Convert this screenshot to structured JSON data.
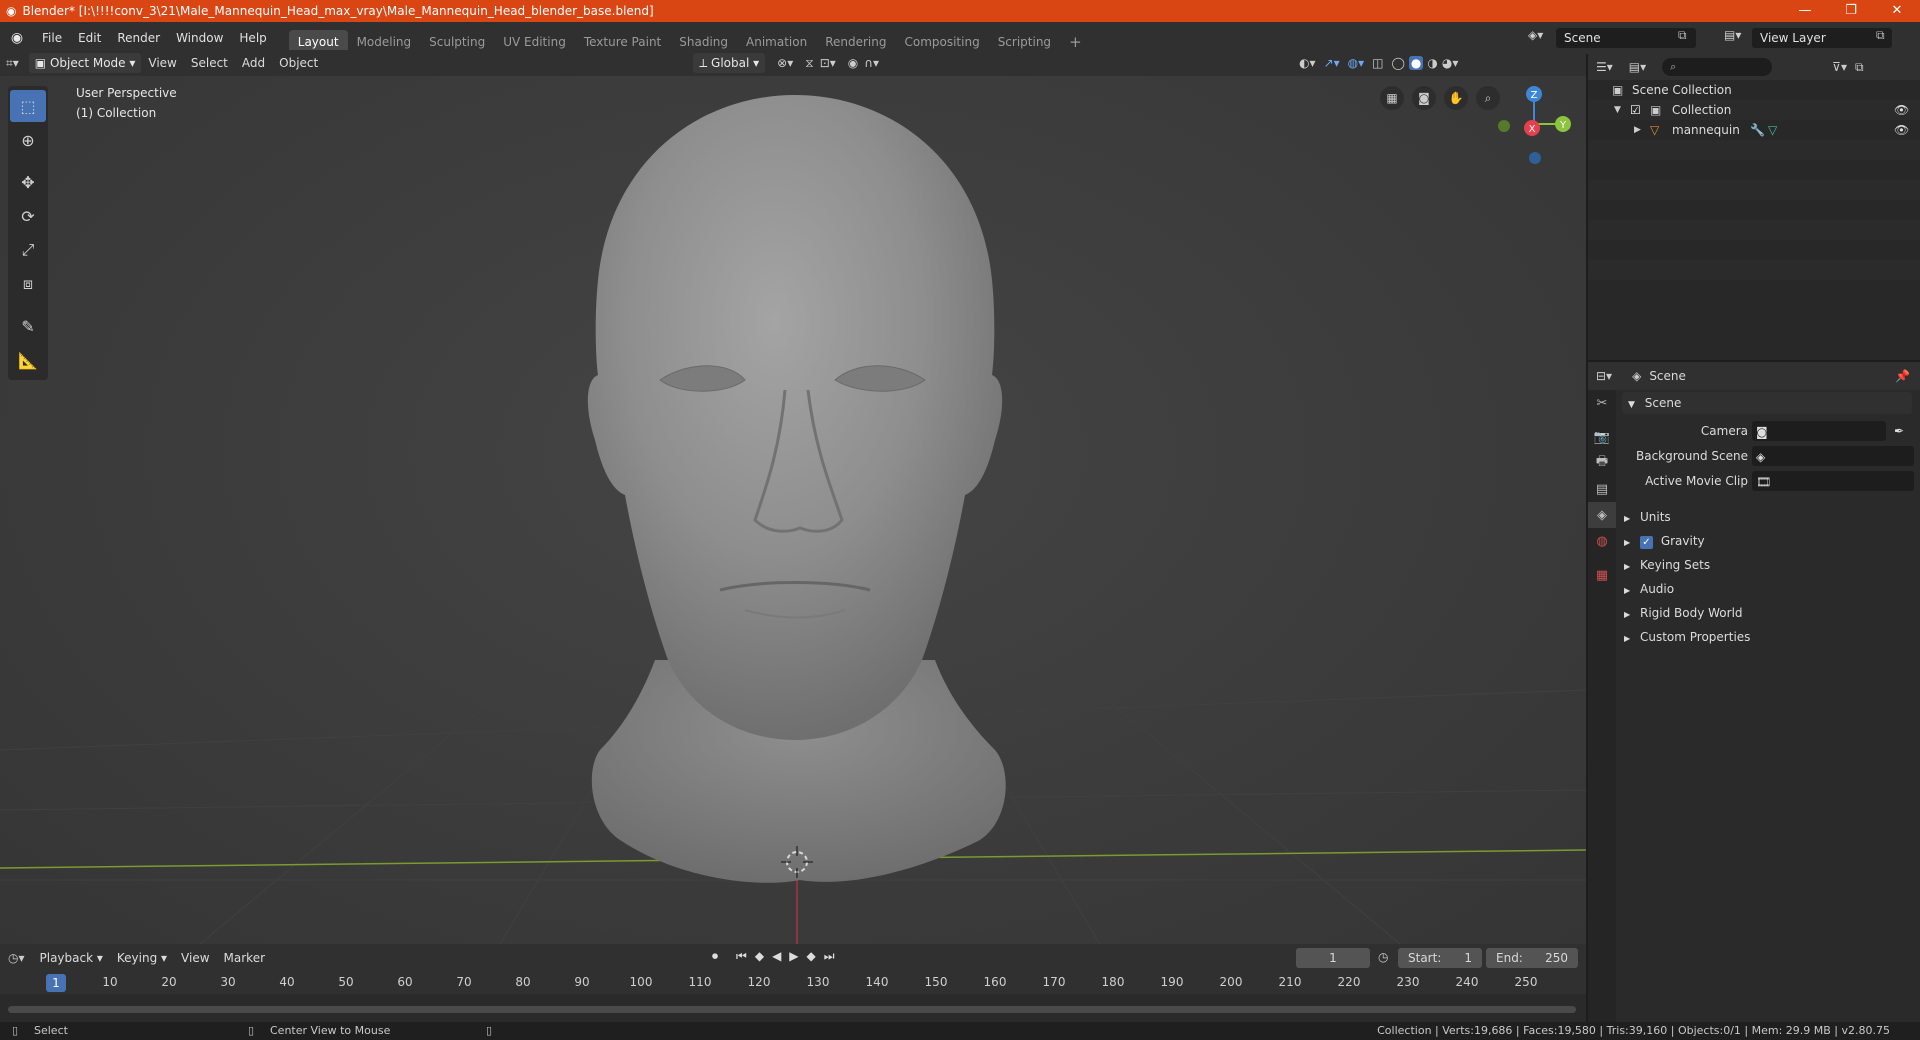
{
  "window": {
    "title": "Blender* [I:\\!!!!conv_3\\21\\Male_Mannequin_Head_max_vray\\Male_Mannequin_Head_blender_base.blend]",
    "minimize": "—",
    "maximize": "❐",
    "close": "✕"
  },
  "menu": [
    "File",
    "Edit",
    "Render",
    "Window",
    "Help"
  ],
  "workspaces": [
    "Layout",
    "Modeling",
    "Sculpting",
    "UV Editing",
    "Texture Paint",
    "Shading",
    "Animation",
    "Rendering",
    "Compositing",
    "Scripting"
  ],
  "active_workspace": "Layout",
  "scene_selector": "Scene",
  "view_layer_selector": "View Layer",
  "viewport_header": {
    "mode": "Object Mode",
    "menus": [
      "View",
      "Select",
      "Add",
      "Object"
    ],
    "transform_orientation": "Global"
  },
  "viewport": {
    "perspective_label": "User Perspective",
    "collection_label": "(1) Collection",
    "gizmo_axes": {
      "z": "Z",
      "y": "Y",
      "x": "X"
    }
  },
  "outliner": {
    "rows": [
      {
        "label": "Scene Collection"
      },
      {
        "label": "Collection"
      },
      {
        "label": "mannequin"
      }
    ]
  },
  "properties": {
    "header_title": "Scene",
    "panel_title": "Scene",
    "fields": [
      {
        "label": "Camera"
      },
      {
        "label": "Background Scene"
      },
      {
        "label": "Active Movie Clip"
      }
    ],
    "sections": [
      {
        "label": "Units"
      },
      {
        "label": "Gravity",
        "checked": true
      },
      {
        "label": "Keying Sets"
      },
      {
        "label": "Audio"
      },
      {
        "label": "Rigid Body World"
      },
      {
        "label": "Custom Properties"
      }
    ]
  },
  "timeline": {
    "menus": [
      "Playback",
      "Keying",
      "View",
      "Marker"
    ],
    "current_frame": "1",
    "start_label": "Start:",
    "start_value": "1",
    "end_label": "End:",
    "end_value": "250",
    "ruler_labels": [
      "1",
      "10",
      "20",
      "30",
      "40",
      "50",
      "60",
      "70",
      "80",
      "90",
      "100",
      "110",
      "120",
      "130",
      "140",
      "150",
      "160",
      "170",
      "180",
      "190",
      "200",
      "210",
      "220",
      "230",
      "240",
      "250"
    ]
  },
  "statusbar": {
    "left_action": "Select",
    "middle_action": "Center View to Mouse",
    "stats": "Collection | Verts:19,686 | Faces:19,580 | Tris:39,160 | Objects:0/1 | Mem: 29.9 MB | v2.80.75"
  },
  "colors": {
    "titlebar": "#d94614",
    "accent": "#4772b3",
    "x_axis": "#e4404d",
    "y_axis": "#8bc53f",
    "z_axis": "#3d86d8"
  }
}
